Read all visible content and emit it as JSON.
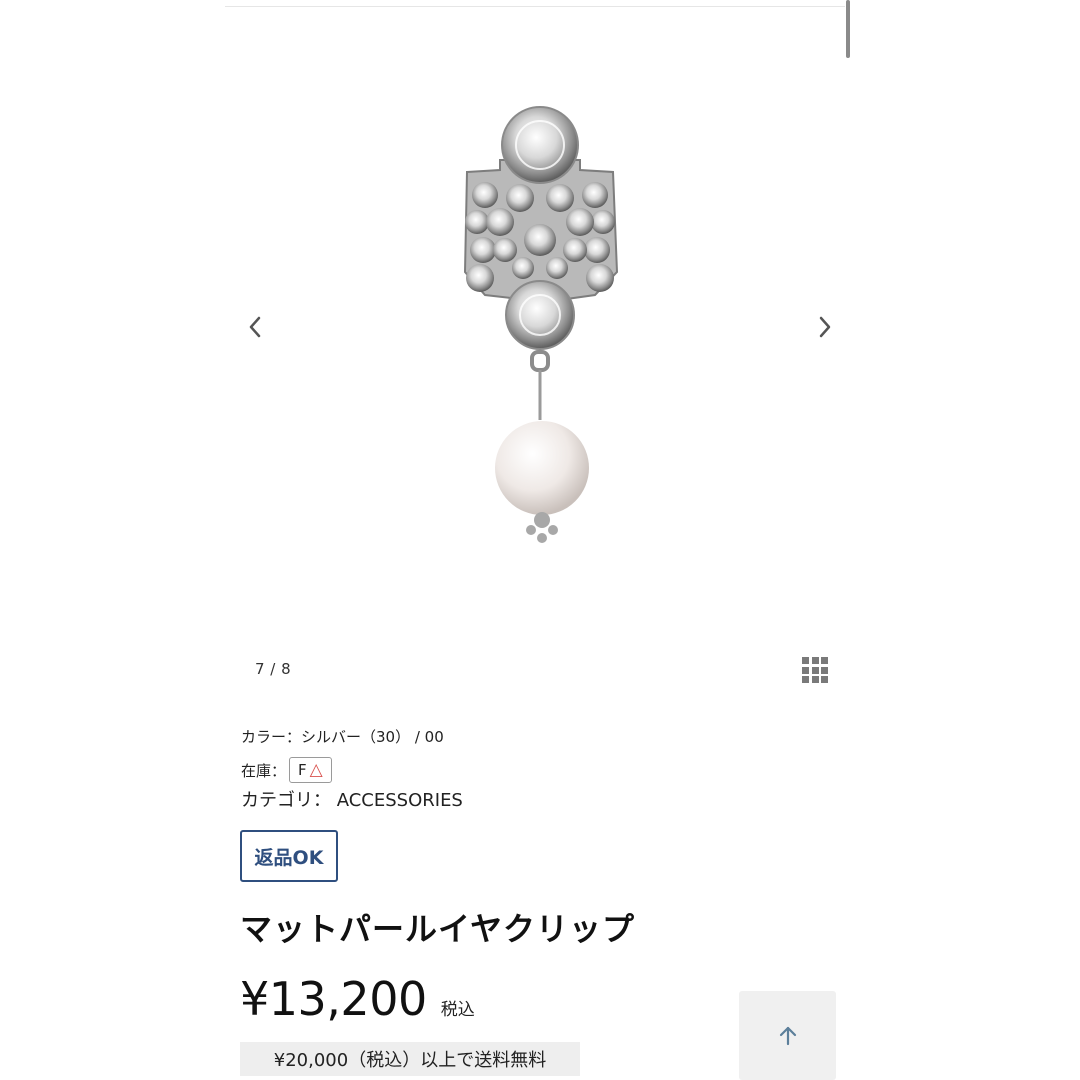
{
  "gallery": {
    "current": "7",
    "total": "8",
    "counter_text": "7 / 8",
    "prev_icon": "chevron-left-icon",
    "next_icon": "chevron-right-icon",
    "grid_icon": "grid-view-icon"
  },
  "product": {
    "color_text": "カラー：シルバー（30）  /  00",
    "stock_label": "在庫：",
    "stock_size": "F",
    "stock_mark": "△",
    "category_text": "カテゴリ： ACCESSORIES",
    "return_badge": "返品OK",
    "title": "マットパールイヤクリップ",
    "price": "¥13,200",
    "tax_label": "税込",
    "shipping_note": "¥20,000（税込）以上で送料無料"
  },
  "colors": {
    "accent_navy": "#2f4f7f",
    "stock_mark_red": "#d9534f",
    "note_bg": "#eeeeee"
  },
  "scroll_top_icon": "arrow-up-icon"
}
